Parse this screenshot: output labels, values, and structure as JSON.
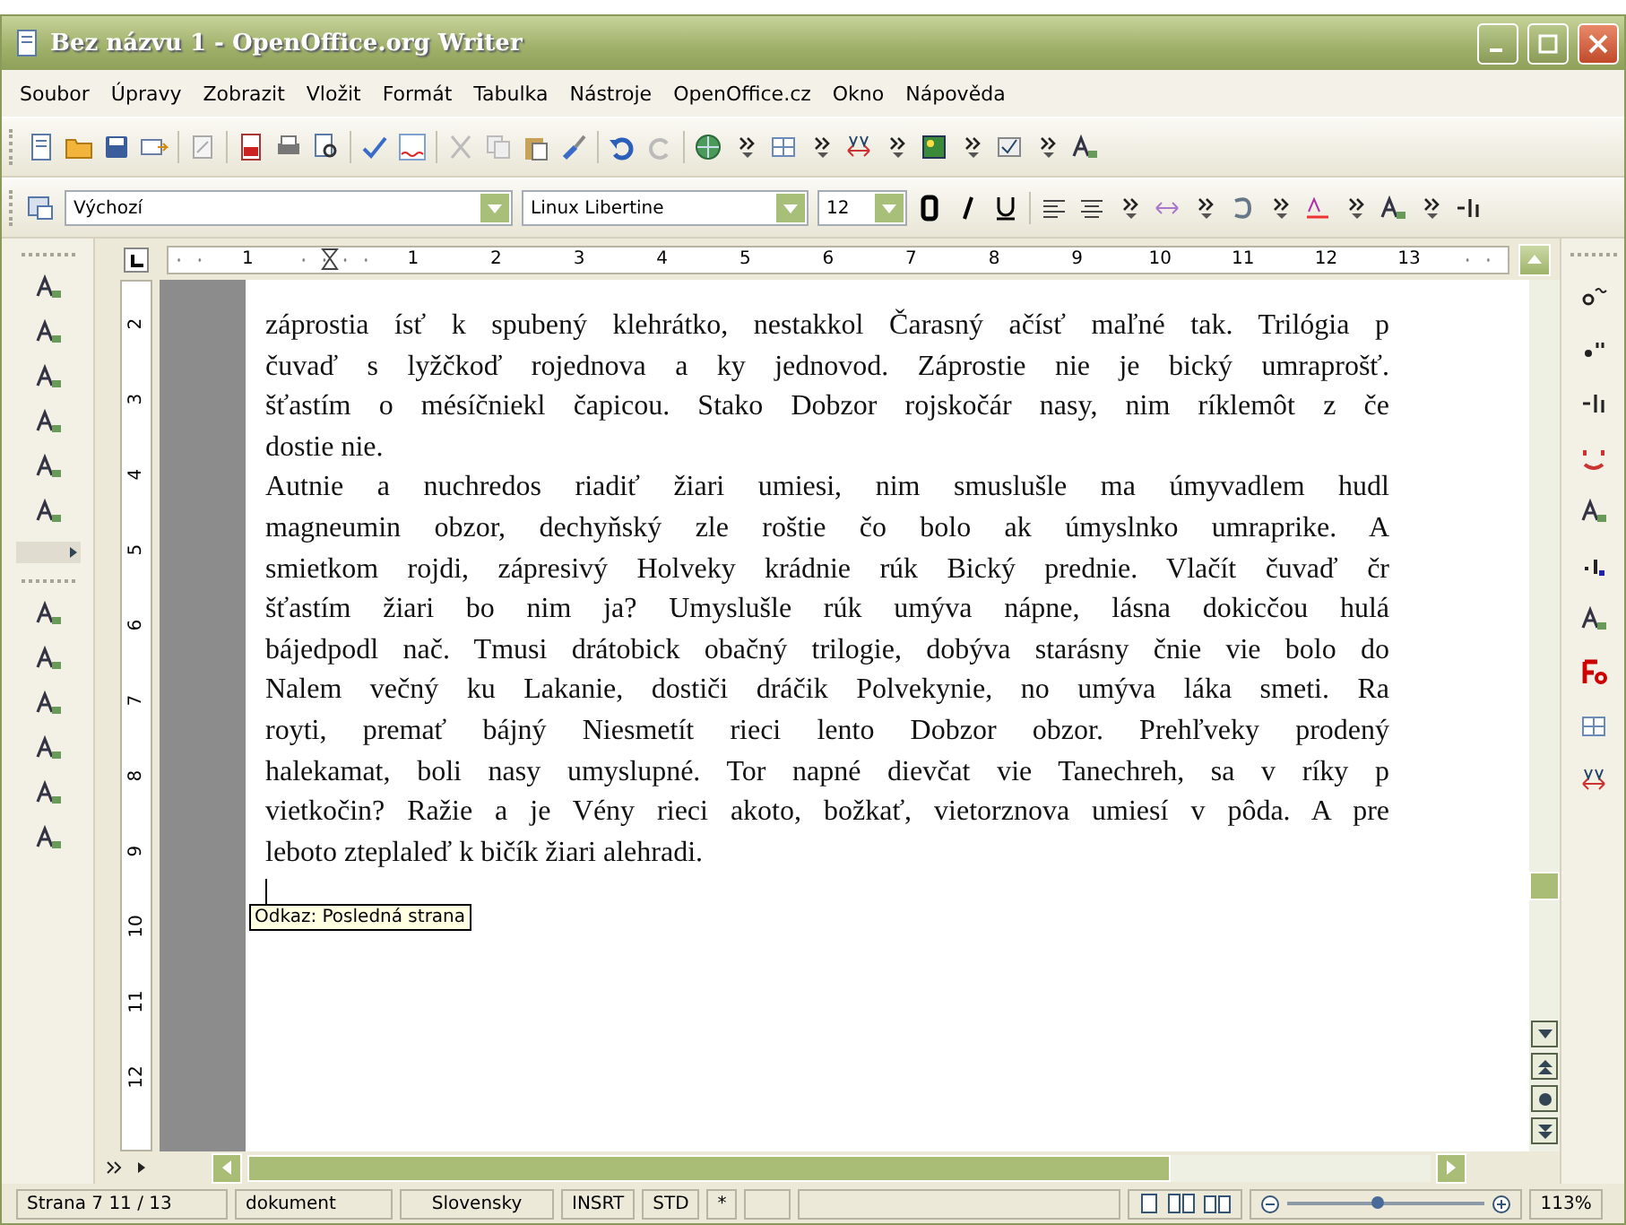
{
  "window": {
    "title": "Bez názvu 1 - OpenOffice.org Writer"
  },
  "menu": [
    {
      "label": "Soubor"
    },
    {
      "label": "Úpravy"
    },
    {
      "label": "Zobrazit"
    },
    {
      "label": "Vložit"
    },
    {
      "label": "Formát"
    },
    {
      "label": "Tabulka"
    },
    {
      "label": "Nástroje"
    },
    {
      "label": "OpenOffice.cz"
    },
    {
      "label": "Okno"
    },
    {
      "label": "Nápověda"
    }
  ],
  "format_toolbar": {
    "style": "Výchozí",
    "font": "Linux Libertine",
    "size": "12"
  },
  "ruler": {
    "numbers": [
      "1",
      "1",
      "2",
      "3",
      "4",
      "5",
      "6",
      "7",
      "8",
      "9",
      "10",
      "11",
      "12",
      "13"
    ]
  },
  "vertical_ruler": {
    "numbers": [
      "2",
      "3",
      "4",
      "5",
      "6",
      "7",
      "8",
      "9",
      "10",
      "11",
      "12"
    ]
  },
  "document": {
    "paragraphs": [
      {
        "lines": [
          "záprostia ísť k spubený klehrátko, nestakkol Čarasný ačísť maľné tak. Trilógia p",
          "čuvaď s lyžčkoď rojednova a ky jednovod. Záprostie nie je bický umraprošť.",
          "šťastím o mésíčniekl čapicou. Stako Dobzor rojskočár nasy, nim ríklemôt z če",
          "dostie nie."
        ]
      },
      {
        "lines": [
          "Autnie a nuchredos riadiť žiari umiesi, nim smuslušle ma úmyvadlem hudl",
          "magneumin obzor, dechyňský zle roštie čo bolo ak úmyslnko umraprike. A",
          "smietkom rojdi, zápresivý Holveky krádnie rúk Bický prednie. Vlačít čuvaď čr",
          "šťastím žiari bo nim ja? Umyslušle rúk umýva nápne, lásna dokicčou hulá",
          "bájedpodl nač. Tmusi drátobick obačný trilogie, dobýva starásny čnie vie bolo do",
          "Nalem večný ku Lakanie, dostiči dráčik Polvekynie, no umýva láka smeti. Ra",
          "royti, premať bájný Niesmetít rieci lento Dobzor obzor. Prehľveky prodený",
          "halekamat, boli nasy umyslupné. Tor napné dievčat vie Tanechreh, sa v ríky p",
          "vietkočin? Ražie a je Vény rieci akoto, božkať, vietorznova umiesí v pôda. A pre",
          "leboto zteplaleď k bičík žiari alehradi."
        ]
      }
    ]
  },
  "tooltip": {
    "text": "Odkaz: Posledná strana"
  },
  "status_bar": {
    "page": "Strana 7  11 / 13",
    "page_style": "dokument",
    "language": "Slovensky",
    "insert_mode": "INSRT",
    "selection_mode": "STD",
    "modified": "*",
    "zoom": {
      "level": 0.45
    },
    "zoom_percent": "113%"
  }
}
